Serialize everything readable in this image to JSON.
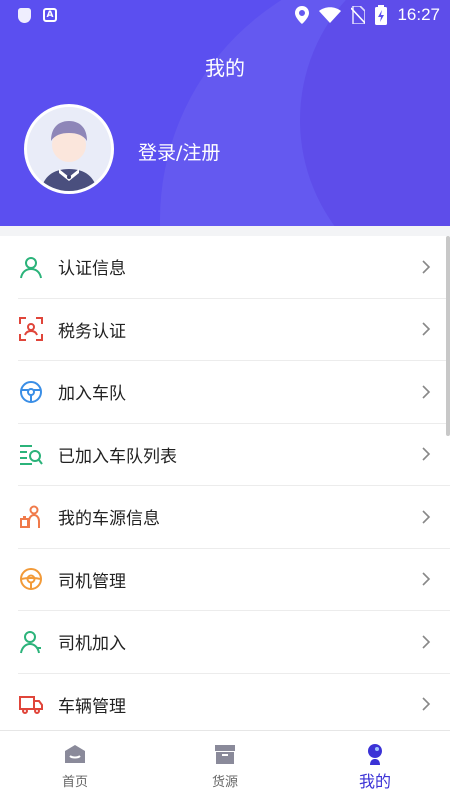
{
  "status_bar": {
    "time": "16:27",
    "badge": "A"
  },
  "header": {
    "title": "我的",
    "login_label": "登录/注册"
  },
  "menu": {
    "items": [
      {
        "label": "认证信息",
        "icon": "user-icon"
      },
      {
        "label": "税务认证",
        "icon": "tax-scan-icon"
      },
      {
        "label": "加入车队",
        "icon": "steering-wheel-icon"
      },
      {
        "label": "已加入车队列表",
        "icon": "list-search-icon"
      },
      {
        "label": "我的车源信息",
        "icon": "driver-person-icon"
      },
      {
        "label": "司机管理",
        "icon": "steering-wheel-orange-icon"
      },
      {
        "label": "司机加入",
        "icon": "user-add-icon"
      },
      {
        "label": "车辆管理",
        "icon": "truck-icon"
      }
    ]
  },
  "tabbar": {
    "tabs": [
      {
        "label": "首页",
        "icon": "home-icon",
        "active": false
      },
      {
        "label": "货源",
        "icon": "cargo-box-icon",
        "active": false
      },
      {
        "label": "我的",
        "icon": "profile-icon",
        "active": true
      }
    ]
  },
  "colors": {
    "primary": "#5b4ff0",
    "active_tab": "#3b32d6"
  }
}
